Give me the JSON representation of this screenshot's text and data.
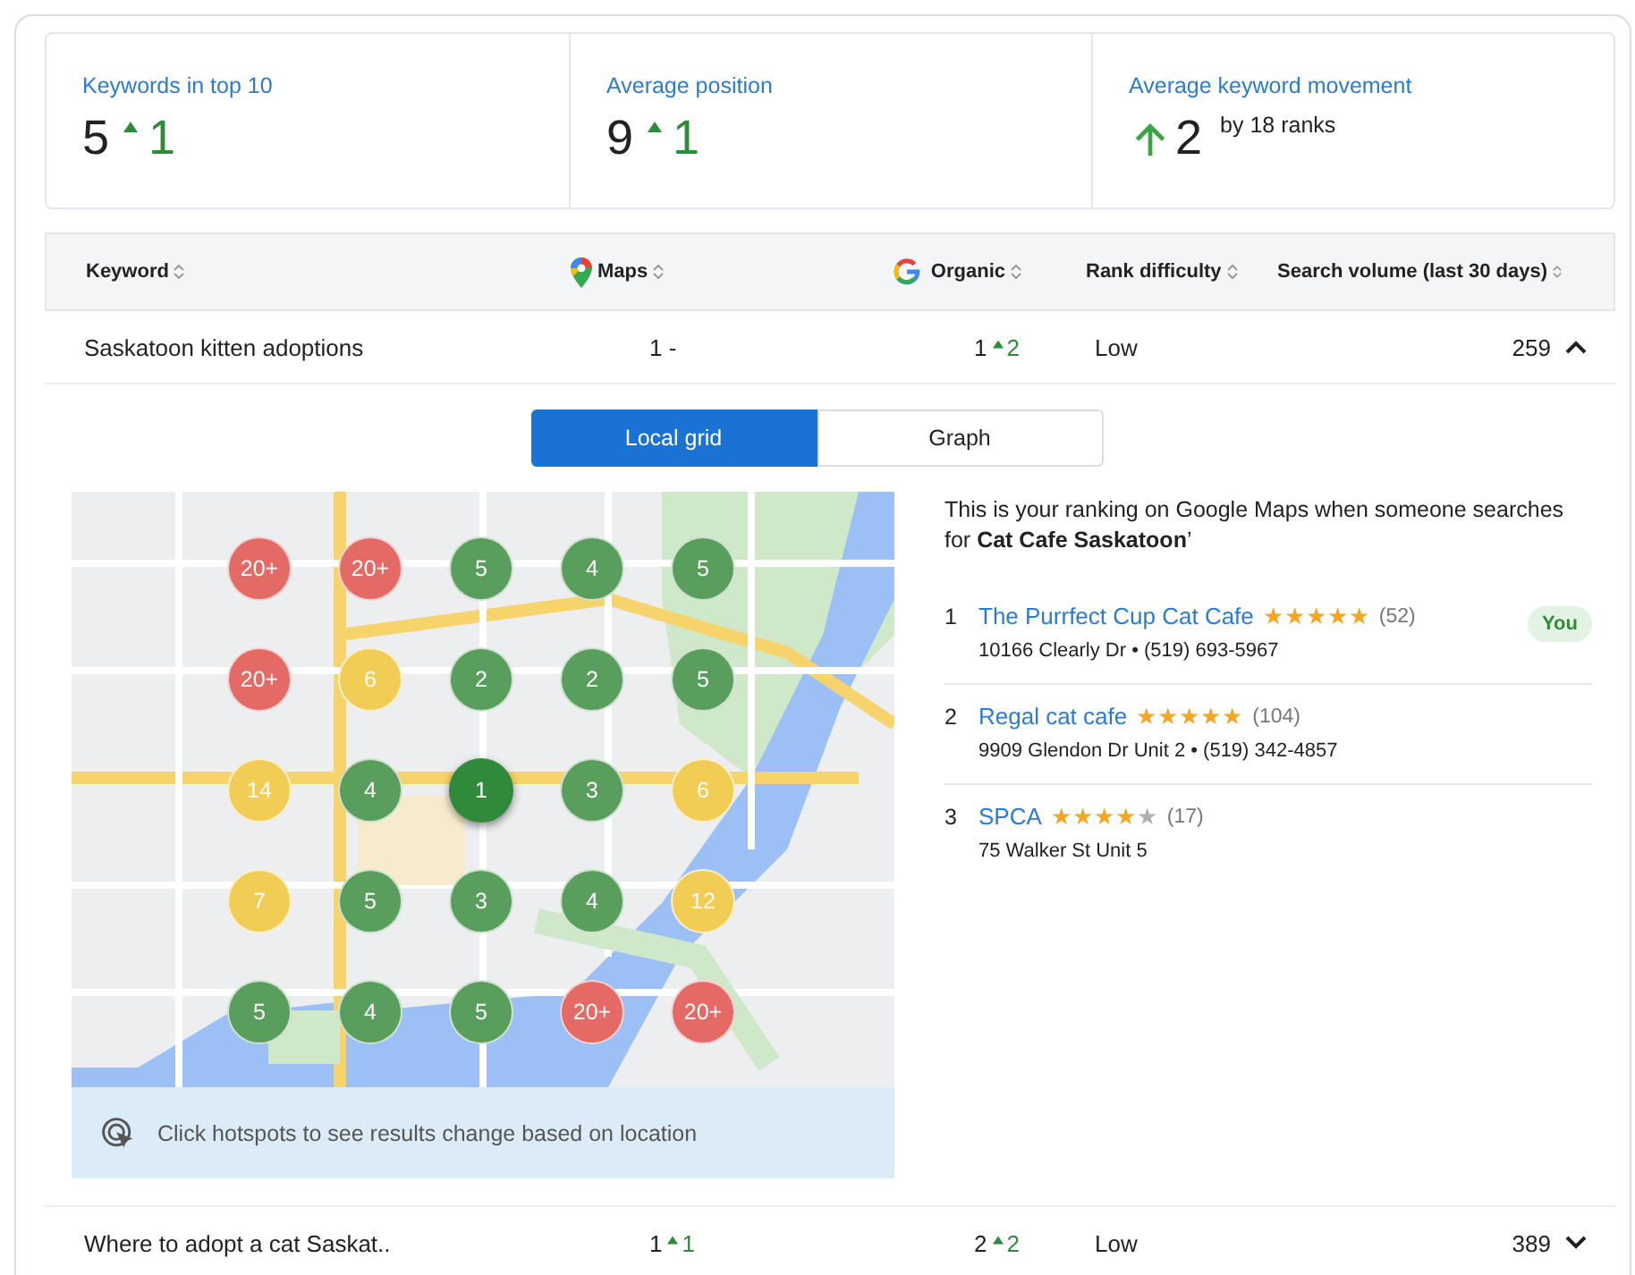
{
  "stats": [
    {
      "label": "Keywords in top 10",
      "value": "5",
      "kind": "caret",
      "change": "1"
    },
    {
      "label": "Average position",
      "value": "9",
      "kind": "caret",
      "change": "1"
    },
    {
      "label": "Average keyword movement",
      "value": "2",
      "kind": "arrow",
      "note": "by 18 ranks"
    }
  ],
  "table": {
    "columns": [
      {
        "label": "Keyword",
        "kind": "plain"
      },
      {
        "label": "Maps",
        "kind": "maps"
      },
      {
        "label": "Organic",
        "kind": "google"
      },
      {
        "label": "Rank difficulty",
        "kind": "plain"
      },
      {
        "label": "Search volume (last 30 days)",
        "kind": "plain"
      }
    ],
    "rows": [
      {
        "keyword": "Saskatoon kitten adoptions",
        "maps": {
          "value": "1 -"
        },
        "organic": {
          "value": "1",
          "change": "2"
        },
        "difficulty": "Low",
        "volume": "259",
        "expanded": true
      },
      {
        "keyword": "Where to adopt a cat Saskat..",
        "maps": {
          "value": "1",
          "change": "1"
        },
        "organic": {
          "value": "2",
          "change": "2"
        },
        "difficulty": "Low",
        "volume": "389",
        "expanded": false
      }
    ]
  },
  "detail": {
    "tabs": [
      {
        "label": "Local grid",
        "selected": true
      },
      {
        "label": "Graph",
        "selected": false
      }
    ],
    "hotspots": [
      {
        "label": "20+",
        "color": "#e46a66",
        "selected": false
      },
      {
        "label": "20+",
        "color": "#e46a66",
        "selected": false
      },
      {
        "label": "5",
        "color": "#5a9e5e",
        "selected": false
      },
      {
        "label": "4",
        "color": "#5a9e5e",
        "selected": false
      },
      {
        "label": "5",
        "color": "#5a9e5e",
        "selected": false
      },
      {
        "label": "20+",
        "color": "#e46a66",
        "selected": false
      },
      {
        "label": "6",
        "color": "#f1cd55",
        "selected": false
      },
      {
        "label": "2",
        "color": "#5a9e5e",
        "selected": false
      },
      {
        "label": "2",
        "color": "#5a9e5e",
        "selected": false
      },
      {
        "label": "5",
        "color": "#5a9e5e",
        "selected": false
      },
      {
        "label": "14",
        "color": "#f1cd55",
        "selected": false
      },
      {
        "label": "4",
        "color": "#5a9e5e",
        "selected": false
      },
      {
        "label": "1",
        "color": "#2f8a3a",
        "selected": true
      },
      {
        "label": "3",
        "color": "#5a9e5e",
        "selected": false
      },
      {
        "label": "6",
        "color": "#f1cd55",
        "selected": false
      },
      {
        "label": "7",
        "color": "#f1cd55",
        "selected": false
      },
      {
        "label": "5",
        "color": "#5a9e5e",
        "selected": false
      },
      {
        "label": "3",
        "color": "#5a9e5e",
        "selected": false
      },
      {
        "label": "4",
        "color": "#5a9e5e",
        "selected": false
      },
      {
        "label": "12",
        "color": "#f1cd55",
        "selected": false
      },
      {
        "label": "5",
        "color": "#5a9e5e",
        "selected": false
      },
      {
        "label": "4",
        "color": "#5a9e5e",
        "selected": false
      },
      {
        "label": "5",
        "color": "#5a9e5e",
        "selected": false
      },
      {
        "label": "20+",
        "color": "#e46a66",
        "selected": false
      },
      {
        "label": "20+",
        "color": "#e46a66",
        "selected": false
      }
    ],
    "hint": "Click hotspots to see results change based on location",
    "description": "This is your ranking on Google Maps when someone searches for **Cat Cafe Saskatoon**’",
    "results": [
      {
        "rank": "1",
        "name": "The Purrfect Cup Cat Cafe",
        "stars": 5,
        "reviews": "(52)",
        "address": "10166 Clearly Dr • (519) 693-5967",
        "badge": "You"
      },
      {
        "rank": "2",
        "name": "Regal cat cafe",
        "stars": 5,
        "reviews": "(104)",
        "address": "9909 Glendon Dr Unit 2 • (519) 342-4857"
      },
      {
        "rank": "3",
        "name": "SPCA",
        "stars": 4,
        "reviews": "(17)",
        "address": "75 Walker St Unit 5"
      }
    ]
  }
}
